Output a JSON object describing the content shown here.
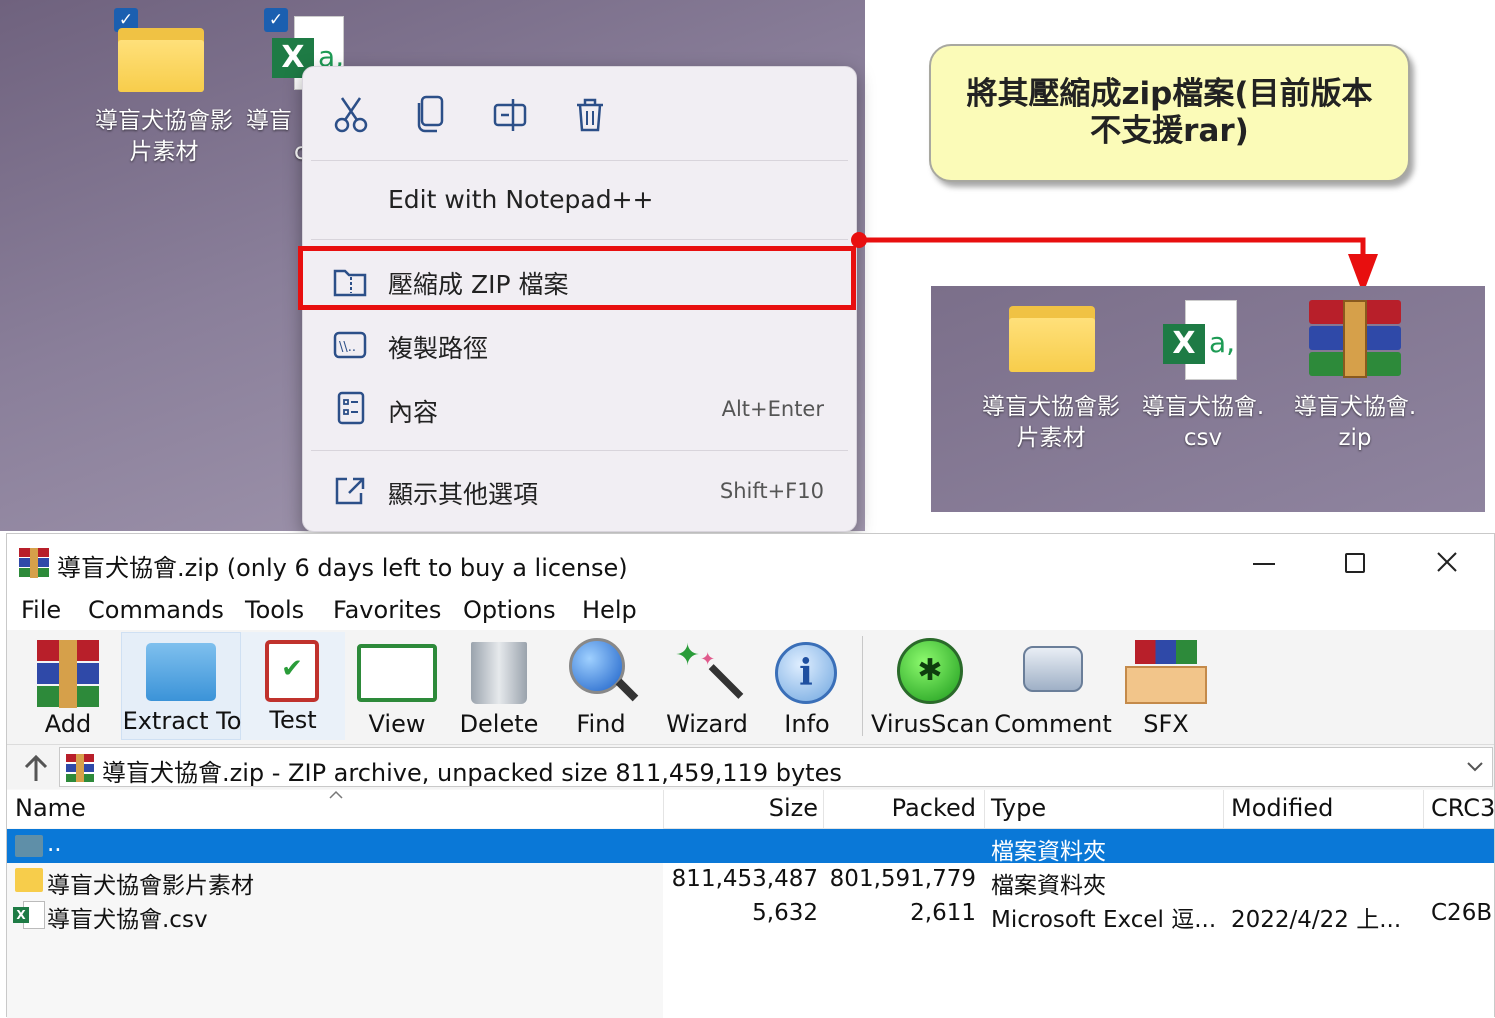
{
  "desktop": {
    "icons": [
      {
        "label_line1": "導盲犬協會影",
        "label_line2": "片素材",
        "type": "folder",
        "checked": true
      },
      {
        "label_line1": "導盲",
        "label_line2": "c",
        "type": "excel",
        "checked": true
      }
    ]
  },
  "context_menu": {
    "top_icons": [
      "cut-icon",
      "copy-icon",
      "rename-icon",
      "delete-icon"
    ],
    "items": [
      {
        "label": "Edit with Notepad++",
        "shortcut": ""
      },
      {
        "label": "壓縮成 ZIP 檔案",
        "shortcut": "",
        "icon": "zip-folder-icon"
      },
      {
        "label": "複製路徑",
        "shortcut": "",
        "icon": "copy-path-icon"
      },
      {
        "label": "內容",
        "shortcut": "Alt+Enter",
        "icon": "properties-icon"
      },
      {
        "label": "顯示其他選項",
        "shortcut": "Shift+F10",
        "icon": "more-options-icon"
      }
    ]
  },
  "callout": {
    "line1": "將其壓縮成zip檔案(目前版本",
    "line2": "不支援rar)"
  },
  "desktop2": {
    "icons": [
      {
        "line1": "導盲犬協會影",
        "line2": "片素材",
        "type": "folder"
      },
      {
        "line1": "導盲犬協會.",
        "line2": "csv",
        "type": "excel"
      },
      {
        "line1": "導盲犬協會.",
        "line2": "zip",
        "type": "winrar"
      }
    ]
  },
  "winrar": {
    "title": "導盲犬協會.zip (only 6 days left to buy a license)",
    "menu": [
      "File",
      "Commands",
      "Tools",
      "Favorites",
      "Options",
      "Help"
    ],
    "toolbar": [
      "Add",
      "Extract To",
      "Test",
      "View",
      "Delete",
      "Find",
      "Wizard",
      "Info",
      "VirusScan",
      "Comment",
      "SFX"
    ],
    "path_text": "導盲犬協會.zip - ZIP archive, unpacked size 811,459,119 bytes",
    "columns": [
      "Name",
      "Size",
      "Packed",
      "Type",
      "Modified",
      "CRC3"
    ],
    "rows": [
      {
        "name": "..",
        "size": "",
        "packed": "",
        "type": "檔案資料夾",
        "modified": "",
        "crc": "",
        "selected": true
      },
      {
        "name": "導盲犬協會影片素材",
        "size": "811,453,487",
        "packed": "801,591,779",
        "type": "檔案資料夾",
        "modified": "",
        "crc": ""
      },
      {
        "name": "導盲犬協會.csv",
        "size": "5,632",
        "packed": "2,611",
        "type": "Microsoft Excel 逗...",
        "modified": "2022/4/22 上...",
        "crc": "C26B"
      }
    ]
  },
  "colors": {
    "accent_red": "#e80f0f",
    "selection_blue": "#0a78d7",
    "callout_yellow": "#fbfbb8"
  }
}
